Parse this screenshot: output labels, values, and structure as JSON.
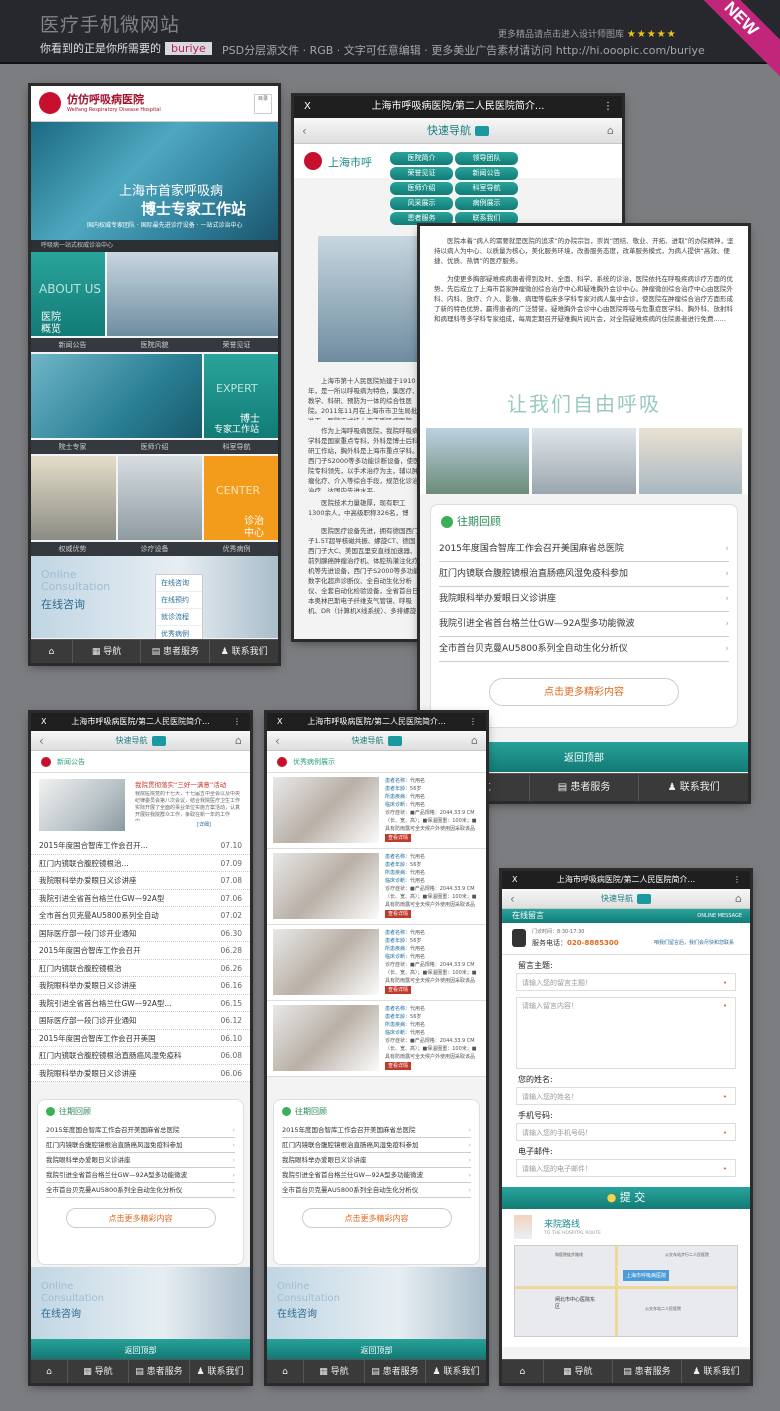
{
  "header": {
    "title": "医疗手机微网站",
    "tagline": "你看到的正是你所需要的",
    "author": "buriye",
    "specs": "PSD分层源文件 · RGB · 文字可任意编辑 · 更多美业广告素材请访问 http://hi.ooopic.com/buriye",
    "promo": "更多精品请点击进入设计师图库",
    "stars": "★★★★★",
    "badge": "NEW"
  },
  "common": {
    "window_title": "上海市呼吸病医院/第二人民医院简介...",
    "close": "X",
    "nav_title": "快速导航",
    "back": "‹",
    "footer": [
      "导航",
      "患者服务",
      "联系我们"
    ],
    "to_top": "返回顶部",
    "more": "点击更多精彩内容",
    "past_title": "往期回顾"
  },
  "p1": {
    "logo": "仿仿呼吸病医院",
    "logo_en": "Weifang Respiratory Disease Hospital",
    "menu_label": "目录",
    "hero_line1": "上海市首家呼吸病",
    "hero_line2": "博士专家工作站",
    "hero_sub": "国内权威专家团队 · 国际最先进诊疗设备 · 一站式诊治中心",
    "hero_strip": "呼吸病一站式权威诊治中心",
    "tiles": [
      {
        "en": "ABOUT US",
        "cn1": "医院",
        "cn2": "概览"
      },
      {
        "en": "EXPERT",
        "cn1": "博士",
        "cn2": "专家工作站"
      },
      {
        "en": "CENTER",
        "cn1": "诊治",
        "cn2": "中心"
      }
    ],
    "caps1": [
      "新闻公告",
      "医院风貌",
      "荣誉见证"
    ],
    "caps2": [
      "院士专家",
      "医师介绍",
      "科室导航"
    ],
    "caps3": [
      "权威优势",
      "诊疗设备",
      "优秀病例"
    ],
    "consult_en1": "Online",
    "consult_en2": "Consultation",
    "consult_cn": "在线咨询",
    "consult_menu": [
      "在线咨询",
      "在线预约",
      "就诊流程",
      "优秀病例"
    ]
  },
  "p2": {
    "org": "上海市呼",
    "menu": [
      [
        "医院简介",
        "领导团队"
      ],
      [
        "荣誉见证",
        "新闻公告"
      ],
      [
        "医师介绍",
        "科室导航"
      ],
      [
        "风采展示",
        "病例展示"
      ],
      [
        "患者服务",
        "联系我们"
      ]
    ],
    "paras": [
      "上海市第十人民医院始建于1910年，是一所以呼吸病为特色，集医疗、教学、科研、预防为一体的综合性医院。2011年11月在上海市市卫生局批准下，医院正式挂上海市呼吸病医院。",
      "作为上海呼吸病医院，我院呼吸病学科是国家重点专科，外科是博士后科研工作站，胸外科是上海市重点学科。西门子S2000等多功能诊断设备，使医院专科领先，以手术治疗为主，辅以肿瘤化疗、介入等综合手段，规范化诊治治疗，达国内先进水平。",
      "医院技术力量雄厚，现有职工1300余人，中高级职称326名，博士、硕士以上学历96人。",
      "医院医疗设备先进，拥有德国西门子1.5T超导核磁共振、螺旋CT、德国西门子大C、美国瓦里安直线加速器、前列腺癌肿瘤治疗机、体腔热灌注化疗机等先进设备，西门子S2000等多功能数字化超声诊断仪、全自动生化分析仪、全套自动化检验设备，全省首台日本奥林巴斯电子纤维支气管镜、呼吸机、DR（计算机X线系统）、多排螺旋CT、彩色B超和机、美国GE骨科小C、美国强乐Cellsaver 5血液回收机、电视胸腔镜等世界一流医疗设备。"
    ]
  },
  "p3": {
    "paras": [
      "医院本着“病人的需要就是医院的追求”的办院宗旨，崇尚“团结、敬业、开拓、进取”的办院精神，坚持以病人为中心、以质量为核心，美化服务环境，改善服务态度，改革服务模式，为病人提供“高效、便捷、优质、热情”的医疗服务。",
      "为使更多胸部疑难疾病患者得到及时、全面、科学、系统的诊治，医院依托在呼吸疾病诊疗方面的优势，先后成立了上海市首家肿瘤微创综合治疗中心和疑难胸外会诊中心。肿瘤微创综合治疗中心由医院外科、内科、放疗、介入、影像、病理等临床多学科专家对病人集中会诊，使医院在肿瘤综合治疗方面形成了新的特色优势，赢得患者的广泛赞誉。疑难胸外会诊中心由医院呼吸与危重症医学科、胸外科、放射科和病理科等多学科专家组成，每周定期召开疑难胸片阅片会，对全院疑难疾病的住院患者进行免费......"
    ],
    "slogan": "让我们自由呼吸",
    "items": [
      "2015年度国合智库工作会召开美国麻省总医院",
      "肛门内镜联合腹腔镜根治直肠癌风湿免疫科参加",
      "我院眼科举办爱眼日义诊讲座",
      "我院引进全省首台格兰仕GW—92A型多功能微波",
      "全市首台贝克曼AU5800系列全自动生化分析仪"
    ]
  },
  "p4": {
    "section": "新闻公告",
    "news_title": "我院贯彻落实“三好一满意”活动",
    "news_body": "我院医院党的十七大，十七届五中全会以及中央纪律委员会第八次会议，结合我院医疗卫生工作实际开展了全面的事业单位实施方案活动，认真开展好我院群众工作，争取在新一年的工作中......",
    "news_more": "[详细]",
    "rows": [
      [
        "2015年度国合智库工作会召开...",
        "07.10"
      ],
      [
        "肛门内镜联合腹腔镜根治...",
        "07.09"
      ],
      [
        "我院眼科举办爱眼日义诊讲座",
        "07.08"
      ],
      [
        "我院引进全省首台格兰仕GW—92A型",
        "07.06"
      ],
      [
        "全市首台贝克曼AU5800系列全自动",
        "07.02"
      ],
      [
        "国际医疗部一段门诊开业通知",
        "06.30"
      ],
      [
        "2015年度国合智库工作会召开",
        "06.28"
      ],
      [
        "肛门内镜联合腹腔镜根治",
        "06.26"
      ],
      [
        "我院眼科举办爱眼日义诊讲座",
        "06.16"
      ],
      [
        "我院引进全省首台格兰仕GW—92A型...",
        "06.15"
      ],
      [
        "国际医疗部一段门诊开业通知",
        "06.12"
      ],
      [
        "2015年度国合智库工作会召开美国",
        "06.10"
      ],
      [
        "肛门内镜联合腹腔镜根治直肠癌风湿免疫科",
        "06.08"
      ],
      [
        "我院眼科举办爱眼日义诊讲座",
        "06.06"
      ]
    ]
  },
  "p5": {
    "section": "优秀病例展示",
    "patient": {
      "name_k": "患者名称：",
      "name_v": "代用名",
      "age_k": "患者年龄：",
      "age_v": "56岁",
      "type_k": "所患疾病：",
      "type_v": "代用名",
      "diag_k": "临床诊断：",
      "diag_v": "代用名",
      "desc": "诊疗症状：■产品规格：2044.33.9 CM（长、宽、高）；■保温圈重：100米；■具有防雨露可全天候户外使用因采取该品",
      "btn": "查看详情"
    }
  },
  "p6": {
    "bar": "在线留言",
    "bar_en": "ONLINE MESSAGE",
    "hours": "门诊时间：8:30-17:30",
    "phone_k": "服务电话：",
    "phone_v": "020-8885300",
    "hint": "咱我们留言后，我们会尽快和您联系",
    "fields": [
      {
        "label": "留言主题:",
        "ph": "请输入您的留言主题！"
      },
      {
        "label": "",
        "ph": "请输入留言内容！"
      },
      {
        "label": "您的姓名:",
        "ph": "请输入您的姓名！"
      },
      {
        "label": "手机号码:",
        "ph": "请输入您的手机号码！"
      },
      {
        "label": "电子邮件:",
        "ph": "请输入您的电子邮件！"
      }
    ],
    "submit": "提 交",
    "route": "来院路线",
    "route_en": "TO THE HOSPITAL ROUTE",
    "map_label": "上海市呼吸病医院",
    "map_area": "闸北市中心医院东区",
    "map_notes": [
      "和医院徒步路线",
      "公交车站步行二人民医院",
      "公交车站二人民医院"
    ]
  }
}
